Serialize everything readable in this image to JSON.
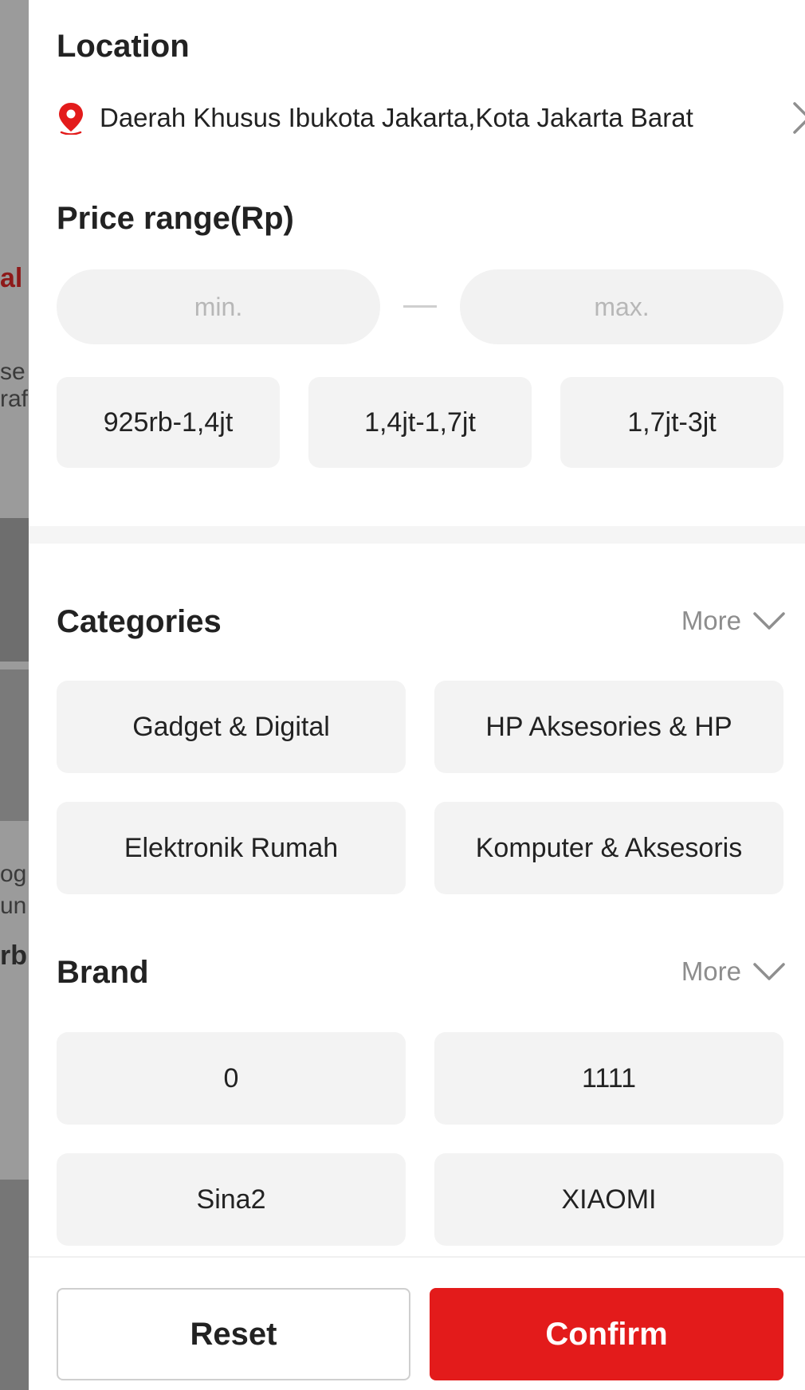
{
  "background_page": {
    "fragments": [
      "al",
      "se",
      "raf",
      "og",
      "un",
      "rb"
    ]
  },
  "location": {
    "title": "Location",
    "value": "Daerah Khusus Ibukota Jakarta,Kota Jakarta Barat",
    "icon": "map-pin-icon",
    "pin_color": "#e31b1b"
  },
  "price_range": {
    "title": "Price range(Rp)",
    "min_placeholder": "min.",
    "max_placeholder": "max.",
    "min_value": "",
    "max_value": "",
    "presets": [
      "925rb-1,4jt",
      "1,4jt-1,7jt",
      "1,7jt-3jt"
    ]
  },
  "categories": {
    "title": "Categories",
    "more_label": "More",
    "items": [
      "Gadget & Digital",
      "HP Aksesories & HP",
      "Elektronik Rumah",
      "Komputer & Aksesoris"
    ]
  },
  "brand": {
    "title": "Brand",
    "more_label": "More",
    "items": [
      "0",
      "1111",
      "Sina2",
      "XIAOMI"
    ]
  },
  "footer": {
    "reset_label": "Reset",
    "confirm_label": "Confirm",
    "confirm_color": "#e31b1b"
  }
}
